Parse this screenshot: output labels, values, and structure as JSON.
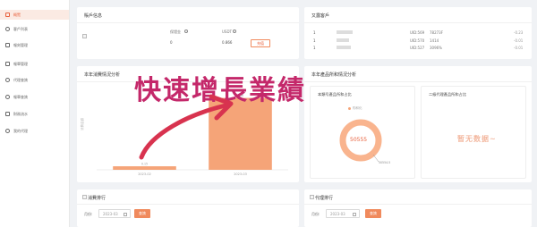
{
  "sidebar": {
    "items": [
      {
        "label": "概覽",
        "active": true
      },
      {
        "label": "客戶列表"
      },
      {
        "label": "報刻管理"
      },
      {
        "label": "報單管理"
      },
      {
        "label": "代理查詢"
      },
      {
        "label": "報單查詢"
      },
      {
        "label": "財務流水"
      },
      {
        "label": "我的代理"
      }
    ]
  },
  "account": {
    "title": "賬戶信息",
    "deposit_label": "保證金",
    "deposit_value": "0",
    "usdt_label": "USDT",
    "usdt_value": "0.866",
    "recharge_button": "充值"
  },
  "referrers": {
    "title": "又露客戶",
    "rows": [
      {
        "prefix": "1",
        "id": "UID:569",
        "mask": "78273F",
        "value": "-0.23"
      },
      {
        "prefix": "1",
        "id": "UID:570",
        "mask": "1414",
        "value": "-0.01"
      },
      {
        "prefix": "1",
        "id": "UID:527",
        "mask": "3096%",
        "value": "-0.01"
      }
    ]
  },
  "consumption": {
    "title": "本年消費情況分析",
    "ylabel": "消費金額"
  },
  "chart_data": {
    "type": "bar",
    "categories": [
      "2023-02",
      "2023-03"
    ],
    "values": [
      0.15,
      3.06
    ],
    "value_labels": [
      "0.15",
      "3.06"
    ],
    "ylim": [
      0,
      3.5
    ],
    "color": "#f5a478"
  },
  "products": {
    "title": "本年產品所和情況分析",
    "left_panel_title": "本類号產品所和占比",
    "legend_label": "购和化",
    "donut_center": "50555",
    "donut_callout": "50554.5",
    "right_panel_title": "二級代理產品所和占比",
    "empty_text": "暂无数据~"
  },
  "ranking_left": {
    "title": "消費排行",
    "date_label": "月份:",
    "date_value": "2023-03",
    "query_button": "查詢"
  },
  "ranking_right": {
    "title": "代理排行",
    "date_label": "月份:",
    "date_value": "2023-03",
    "query_button": "查詢"
  },
  "overlay": {
    "text": "快速增長業績"
  },
  "colors": {
    "accent": "#f08a5d",
    "bar": "#f5a478",
    "overlay_text": "#c4286a",
    "arrow": "#d8334f"
  }
}
